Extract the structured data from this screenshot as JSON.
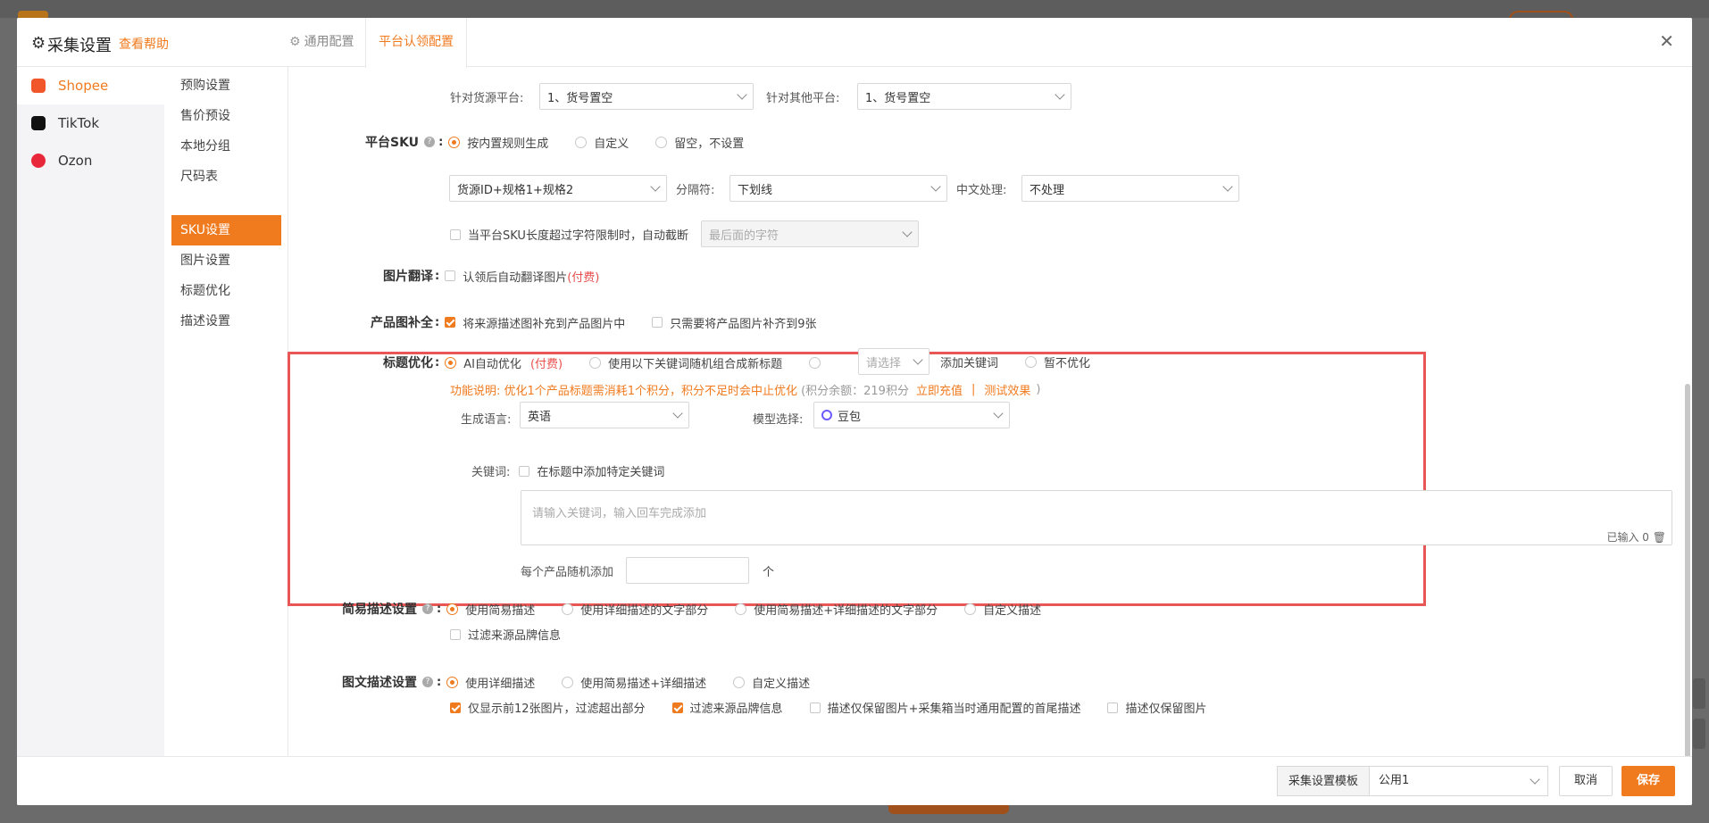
{
  "header": {
    "title": "采集设置",
    "help_link": "查看帮助",
    "tabs": [
      {
        "label": "通用配置",
        "active": false
      },
      {
        "label": "平台认领配置",
        "active": true
      }
    ]
  },
  "platforms": [
    {
      "label": "Shopee",
      "icon": "shopee-icon",
      "active": true
    },
    {
      "label": "TikTok",
      "icon": "tiktok-icon",
      "active": false
    },
    {
      "label": "Ozon",
      "icon": "ozon-icon",
      "active": false
    }
  ],
  "sub_nav": [
    {
      "label": "预购设置",
      "active": false
    },
    {
      "label": "售价预设",
      "active": false
    },
    {
      "label": "本地分组",
      "active": false
    },
    {
      "label": "尺码表",
      "active": false
    },
    {
      "label": "SKU设置",
      "active": true
    },
    {
      "label": "图片设置",
      "active": false
    },
    {
      "label": "标题优化",
      "active": false
    },
    {
      "label": "描述设置",
      "active": false
    }
  ],
  "sku": {
    "source_platform_label": "针对货源平台:",
    "source_platform_value": "1、货号置空",
    "other_platform_label": "针对其他平台:",
    "other_platform_value": "1、货号置空",
    "platform_sku_label": "平台SKU",
    "platform_sku_options": [
      "按内置规则生成",
      "自定义",
      "留空，不设置"
    ],
    "platform_sku_selected": 0,
    "rule_value": "货源ID+规格1+规格2",
    "separator_label": "分隔符:",
    "separator_value": "下划线",
    "chinese_label": "中文处理:",
    "chinese_value": "不处理",
    "truncate_label": "当平台SKU长度超过字符限制时，自动截断",
    "truncate_value": "最后面的字符"
  },
  "image_translate": {
    "label": "图片翻译",
    "option": "认领后自动翻译图片",
    "paid": "(付费)"
  },
  "image_fill": {
    "label": "产品图补全",
    "option1": "将来源描述图补充到产品图片中",
    "option1_checked": true,
    "option2": "只需要将产品图片补齐到9张",
    "option2_checked": false
  },
  "title_opt": {
    "label": "标题优化",
    "ai_option": "AI自动优化",
    "paid": "(付费)",
    "random_option": "使用以下关键词随机组合成新标题",
    "select_placeholder": "请选择",
    "add_keyword": "添加关键词",
    "no_opt": "暂不优化",
    "note_prefix": "功能说明: 优化1个产品标题需消耗1个积分，积分不足时会中止优化",
    "points": "(积分余额：219积分",
    "recharge": "立即充值",
    "divider": "|",
    "test": "测试效果",
    "close_paren": ")",
    "lang_label": "生成语言:",
    "lang_value": "英语",
    "model_label": "模型选择:",
    "model_value": "豆包",
    "keyword_label": "关键词:",
    "keyword_option": "在标题中添加特定关键词",
    "keyword_placeholder": "请输入关键词，输入回车完成添加",
    "input_count": "已输入 0",
    "random_add_label": "每个产品随机添加",
    "unit": "个"
  },
  "simple_desc": {
    "label": "简易描述设置",
    "options": [
      "使用简易描述",
      "使用详细描述的文字部分",
      "使用简易描述+详细描述的文字部分",
      "自定义描述"
    ],
    "selected": 0,
    "filter": "过滤来源品牌信息"
  },
  "rich_desc": {
    "label": "图文描述设置",
    "options": [
      "使用详细描述",
      "使用简易描述+详细描述",
      "自定义描述"
    ],
    "selected": 0,
    "check1": "仅显示前12张图片，过滤超出部分",
    "check2": "过滤来源品牌信息",
    "check3": "描述仅保留图片+采集箱当时通用配置的首尾描述",
    "check4": "描述仅保留图片"
  },
  "footer": {
    "template_label": "采集设置模板",
    "template_value": "公用1",
    "cancel": "取消",
    "save": "保存"
  },
  "colors": {
    "accent": "#f07a1e",
    "highlight": "#e85656",
    "paid": "#e8504e"
  }
}
